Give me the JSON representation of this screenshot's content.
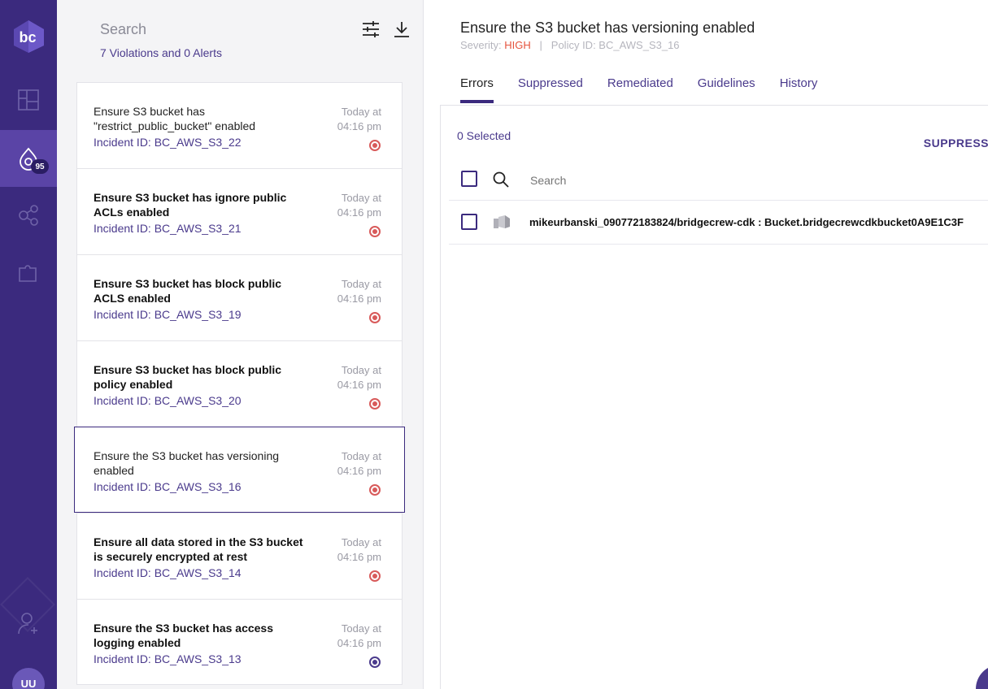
{
  "sidebar": {
    "logo_text": "bc",
    "alerts_badge": "95",
    "avatar_initials": "UU"
  },
  "list": {
    "search_placeholder": "Search",
    "counts_text": "7 Violations and 0 Alerts",
    "cards": [
      {
        "title": "Ensure S3 bucket has \"restrict_public_bucket\" enabled",
        "incident": "Incident ID: BC_AWS_S3_22",
        "time": "Today at 04:16 pm",
        "severity": "high",
        "unread": false
      },
      {
        "title": "Ensure S3 bucket has ignore public ACLs enabled",
        "incident": "Incident ID: BC_AWS_S3_21",
        "time": "Today at 04:16 pm",
        "severity": "high",
        "unread": true
      },
      {
        "title": "Ensure S3 bucket has block public ACLS enabled",
        "incident": "Incident ID: BC_AWS_S3_19",
        "time": "Today at 04:16 pm",
        "severity": "high",
        "unread": true
      },
      {
        "title": "Ensure S3 bucket has block public policy enabled",
        "incident": "Incident ID: BC_AWS_S3_20",
        "time": "Today at 04:16 pm",
        "severity": "high",
        "unread": true
      },
      {
        "title": "Ensure the S3 bucket has versioning enabled",
        "incident": "Incident ID: BC_AWS_S3_16",
        "time": "Today at 04:16 pm",
        "severity": "high",
        "unread": false,
        "selected": true
      },
      {
        "title": "Ensure all data stored in the S3 bucket is securely encrypted at rest",
        "incident": "Incident ID: BC_AWS_S3_14",
        "time": "Today at 04:16 pm",
        "severity": "high",
        "unread": true
      },
      {
        "title": "Ensure the S3 bucket has access logging enabled",
        "incident": "Incident ID: BC_AWS_S3_13",
        "time": "Today at 04:16 pm",
        "severity": "medium",
        "unread": true
      }
    ]
  },
  "detail": {
    "title": "Ensure the S3 bucket has versioning enabled",
    "severity_label": "Severity:",
    "severity_value": "HIGH",
    "separator": "|",
    "policy_id": "Policy ID: BC_AWS_S3_16",
    "tabs": [
      {
        "label": "Errors",
        "active": true
      },
      {
        "label": "Suppressed"
      },
      {
        "label": "Remediated"
      },
      {
        "label": "Guidelines"
      },
      {
        "label": "History"
      }
    ],
    "selected_count": "0 Selected",
    "suppress_label": "SUPPRESS",
    "search_placeholder": "Search",
    "resources": [
      {
        "name": "mikeurbanski_090772183824/bridgecrew-cdk : Bucket.bridgecrewcdkbucket0A9E1C3F"
      }
    ]
  },
  "colors": {
    "sidebar": "#3b2a7e",
    "accent": "#4a3a8c",
    "high": "#e5533d"
  }
}
